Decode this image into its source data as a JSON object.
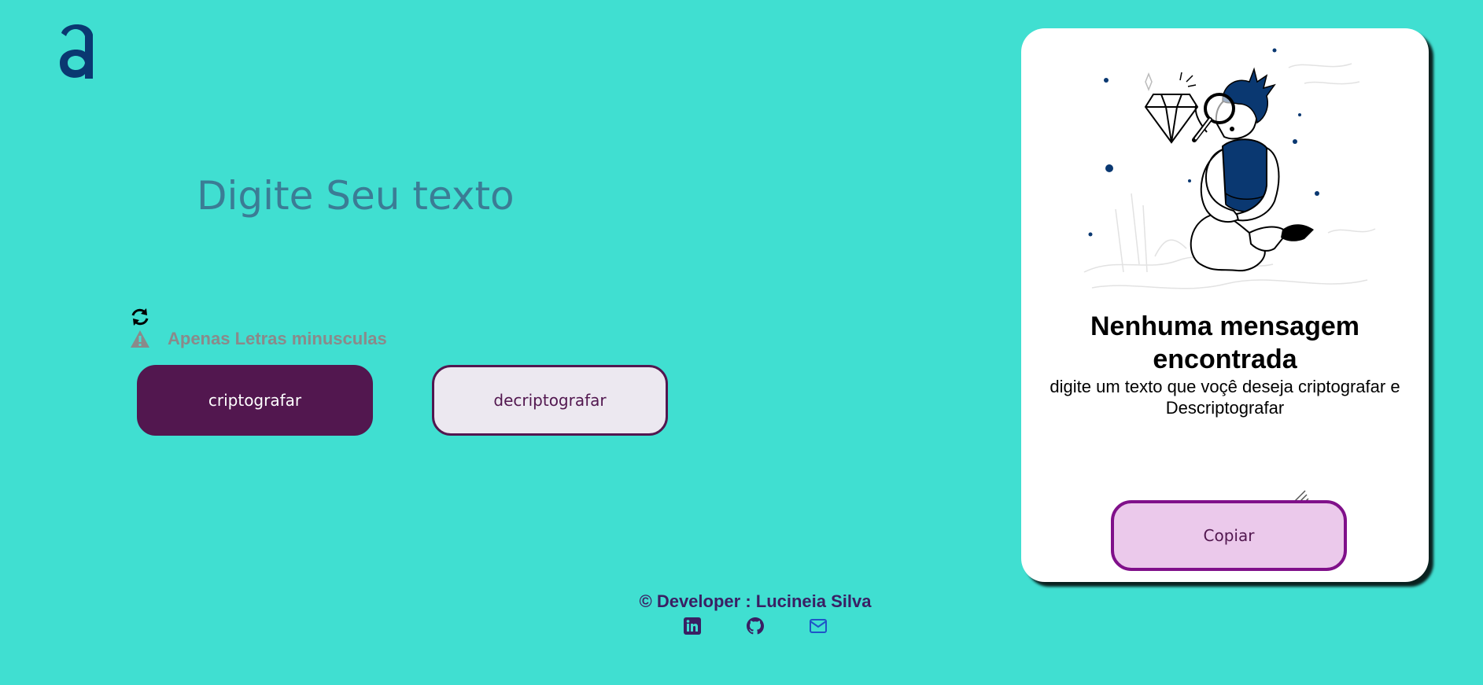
{
  "logo": {
    "icon": "alura-a-logo-icon",
    "color": "#0a3871"
  },
  "input": {
    "placeholder": "Digite Seu texto",
    "value": ""
  },
  "refresh": {
    "icon": "refresh-icon"
  },
  "hint": {
    "icon": "warning-icon",
    "text": "Apenas Letras minusculas"
  },
  "buttons": {
    "encrypt_label": "criptografar",
    "decrypt_label": "decriptografar"
  },
  "output_card": {
    "illustration": "person-with-magnifying-glass-illustration",
    "title": "Nenhuma mensagem encontrada",
    "subtitle": "digite um texto que voçê deseja criptografar e Descriptografar",
    "copy_label": "Copiar"
  },
  "footer": {
    "credit": "© Developer : Lucineia Silva",
    "socials": [
      {
        "icon": "linkedin-icon"
      },
      {
        "icon": "github-icon"
      },
      {
        "icon": "email-icon"
      }
    ]
  },
  "colors": {
    "background": "#40dfd1",
    "primary": "#52174f",
    "accent": "#80108a",
    "copy_bg": "#ebc9eb",
    "placeholder": "#3b7c95"
  }
}
